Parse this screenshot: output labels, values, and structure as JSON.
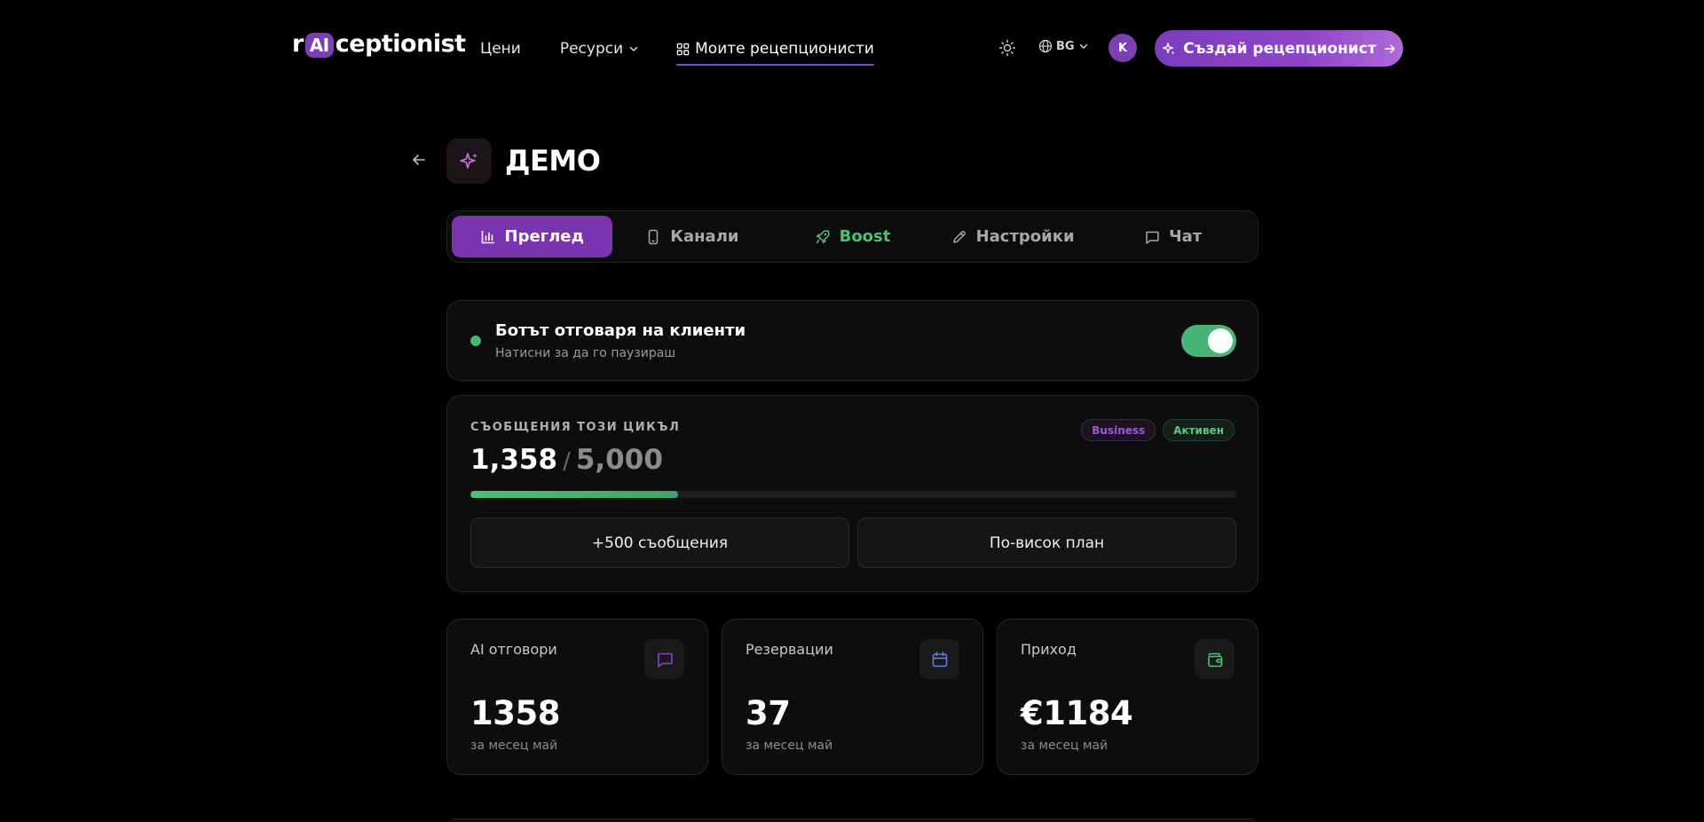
{
  "header": {
    "logo": {
      "prefix": "r",
      "badge": "AI",
      "suffix": "ceptionist"
    },
    "nav": {
      "prices": "Цени",
      "resources": "Ресурси",
      "my_assistants": "Моите рецепционисти"
    },
    "language": "BG",
    "avatar_initial": "K",
    "create_button": "Създай рецепционист"
  },
  "page": {
    "title": "ДЕМО"
  },
  "tabs": [
    {
      "label": "Преглед",
      "icon": "bar-chart-icon",
      "active": true
    },
    {
      "label": "Канали",
      "icon": "smartphone-icon"
    },
    {
      "label": "Boost",
      "icon": "rocket-icon"
    },
    {
      "label": "Настройки",
      "icon": "pencil-icon"
    },
    {
      "label": "Чат",
      "icon": "chat-bubble-icon"
    }
  ],
  "bot_status": {
    "title": "Ботът отговаря на клиенти",
    "subtitle": "Натисни за да го паузираш",
    "enabled": true
  },
  "usage": {
    "label": "СЪОБЩЕНИЯ ТОЗИ ЦИКЪЛ",
    "used": "1,358",
    "separator": "/",
    "limit": "5,000",
    "progress_fraction": 0.2716,
    "plan_badge": "Business",
    "status_badge": "Активен",
    "add_button": "+500 съобщения",
    "upgrade_button": "По-висок план"
  },
  "stats": [
    {
      "label": "AI отговори",
      "value": "1358",
      "sub": "за месец май",
      "icon": "chat-bubble-icon",
      "color": "#8b45c4"
    },
    {
      "label": "Резервации",
      "value": "37",
      "sub": "за месец май",
      "icon": "calendar-icon",
      "color": "#5b7ee8"
    },
    {
      "label": "Приход",
      "value": "€1184",
      "sub": "за месец май",
      "icon": "wallet-icon",
      "color": "#4fbf78"
    }
  ],
  "colors": {
    "accent": "#7b34b0",
    "success": "#49b477",
    "background": "#000000"
  }
}
